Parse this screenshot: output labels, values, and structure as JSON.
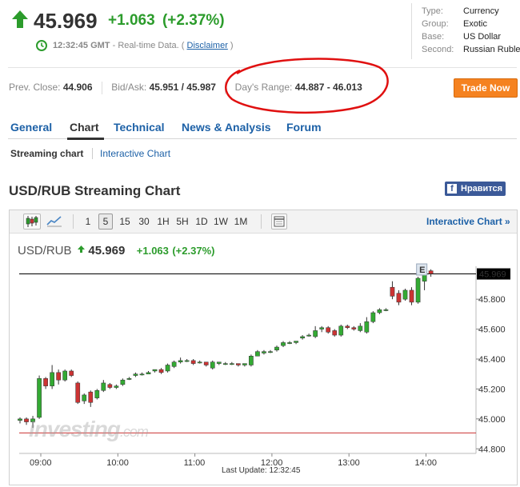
{
  "quote": {
    "last": "45.969",
    "change": "+1.063",
    "change_pct": "(+2.37%)",
    "time": "12:32:45 GMT",
    "realtime_text": "- Real-time Data. (",
    "disclaimer": "Disclaimer",
    "close_paren": ")"
  },
  "info": {
    "type_label": "Type:",
    "type_value": "Currency",
    "group_label": "Group:",
    "group_value": "Exotic",
    "base_label": "Base:",
    "base_value": "US Dollar",
    "second_label": "Second:",
    "second_value": "Russian Ruble"
  },
  "stats": {
    "prev_close_label": "Prev. Close:",
    "prev_close_value": "44.906",
    "bid_ask_label": "Bid/Ask:",
    "bid_ask_value": "45.951 / 45.987",
    "days_range_label": "Day's Range:",
    "days_range_value": "44.887 - 46.013"
  },
  "trade_button": "Trade Now",
  "tabs": [
    "General",
    "Chart",
    "Technical",
    "News & Analysis",
    "Forum"
  ],
  "subtabs": {
    "streaming": "Streaming chart",
    "interactive": "Interactive Chart"
  },
  "page_title": "USD/RUB Streaming Chart",
  "facebook_like": "Нравится",
  "toolbar": {
    "intervals": [
      "1",
      "5",
      "15",
      "30",
      "1H",
      "5H",
      "1D",
      "1W",
      "1M"
    ],
    "selected_interval": "5",
    "interactive_link": "Interactive Chart »"
  },
  "chart_header": {
    "symbol": "USD/RUB",
    "last": "45.969",
    "change": "+1.063",
    "change_pct": "(+2.37%)"
  },
  "watermark": {
    "brand": "investing",
    "suffix": ".com"
  },
  "last_update": "Last Update: 12:32:45",
  "event_marker": "E",
  "colors": {
    "up": "#33aa33",
    "down": "#cc3333",
    "link": "#1d61a7",
    "accent_orange": "#f58220",
    "fb": "#3b5998"
  },
  "icons": [
    "up-arrow-icon",
    "clock-icon",
    "candlestick-icon",
    "line-chart-icon",
    "window-icon",
    "facebook-icon"
  ],
  "chart_data": {
    "type": "candlestick",
    "interval": "5 min",
    "x_ticks": [
      "09:00",
      "10:00",
      "11:00",
      "12:00",
      "13:00",
      "14:00"
    ],
    "y_ticks": [
      "44.800",
      "45.000",
      "45.200",
      "45.400",
      "45.600",
      "45.800"
    ],
    "ylim": [
      44.78,
      46.02
    ],
    "current_price_label": "45.969",
    "current_price": 45.969,
    "prev_close_line": 44.906,
    "start_hour": 8.73,
    "candles": [
      [
        44.99,
        45.0,
        44.97,
        45.01
      ],
      [
        45.0,
        44.98,
        44.96,
        45.01
      ],
      [
        44.98,
        45.0,
        44.94,
        45.02
      ],
      [
        45.01,
        45.27,
        45.0,
        45.29
      ],
      [
        45.27,
        45.22,
        45.2,
        45.28
      ],
      [
        45.22,
        45.31,
        45.2,
        45.36
      ],
      [
        45.31,
        45.26,
        45.23,
        45.33
      ],
      [
        45.26,
        45.32,
        45.25,
        45.33
      ],
      [
        45.32,
        45.29,
        45.28,
        45.33
      ],
      [
        45.24,
        45.11,
        45.1,
        45.25
      ],
      [
        45.12,
        45.16,
        45.1,
        45.17
      ],
      [
        45.18,
        45.11,
        45.08,
        45.19
      ],
      [
        45.14,
        45.19,
        45.13,
        45.2
      ],
      [
        45.19,
        45.24,
        45.18,
        45.26
      ],
      [
        45.23,
        45.21,
        45.2,
        45.24
      ],
      [
        45.21,
        45.22,
        45.2,
        45.23
      ],
      [
        45.23,
        45.26,
        45.22,
        45.27
      ],
      [
        45.27,
        45.27,
        45.26,
        45.28
      ],
      [
        45.29,
        45.3,
        45.28,
        45.31
      ],
      [
        45.3,
        45.3,
        45.29,
        45.31
      ],
      [
        45.3,
        45.31,
        45.3,
        45.32
      ],
      [
        45.32,
        45.33,
        45.31,
        45.33
      ],
      [
        45.33,
        45.31,
        45.3,
        45.34
      ],
      [
        45.32,
        45.36,
        45.31,
        45.37
      ],
      [
        45.35,
        45.38,
        45.34,
        45.39
      ],
      [
        45.38,
        45.39,
        45.37,
        45.41
      ],
      [
        45.39,
        45.39,
        45.38,
        45.4
      ],
      [
        45.39,
        45.37,
        45.36,
        45.4
      ],
      [
        45.38,
        45.38,
        45.37,
        45.39
      ],
      [
        45.38,
        45.36,
        45.35,
        45.38
      ],
      [
        45.34,
        45.38,
        45.33,
        45.39
      ],
      [
        45.37,
        45.38,
        45.36,
        45.38
      ],
      [
        45.37,
        45.37,
        45.36,
        45.38
      ],
      [
        45.37,
        45.37,
        45.36,
        45.38
      ],
      [
        45.37,
        45.36,
        45.35,
        45.37
      ],
      [
        45.36,
        45.37,
        45.35,
        45.37
      ],
      [
        45.36,
        45.42,
        45.35,
        45.43
      ],
      [
        45.42,
        45.45,
        45.42,
        45.46
      ],
      [
        45.44,
        45.45,
        45.43,
        45.46
      ],
      [
        45.45,
        45.45,
        45.44,
        45.46
      ],
      [
        45.46,
        45.48,
        45.45,
        45.49
      ],
      [
        45.49,
        45.51,
        45.48,
        45.52
      ],
      [
        45.51,
        45.51,
        45.5,
        45.52
      ],
      [
        45.51,
        45.52,
        45.5,
        45.52
      ],
      [
        45.54,
        45.55,
        45.53,
        45.56
      ],
      [
        45.56,
        45.56,
        45.55,
        45.57
      ],
      [
        45.55,
        45.59,
        45.54,
        45.62
      ],
      [
        45.6,
        45.61,
        45.58,
        45.62
      ],
      [
        45.61,
        45.58,
        45.57,
        45.62
      ],
      [
        45.59,
        45.56,
        45.55,
        45.6
      ],
      [
        45.56,
        45.62,
        45.55,
        45.63
      ],
      [
        45.62,
        45.61,
        45.6,
        45.63
      ],
      [
        45.61,
        45.6,
        45.59,
        45.62
      ],
      [
        45.59,
        45.62,
        45.58,
        45.64
      ],
      [
        45.58,
        45.65,
        45.57,
        45.68
      ],
      [
        45.65,
        45.71,
        45.64,
        45.72
      ],
      [
        45.71,
        45.73,
        45.7,
        45.74
      ],
      [
        45.73,
        45.73,
        45.72,
        45.74
      ],
      [
        45.88,
        45.82,
        45.8,
        45.92
      ],
      [
        45.84,
        45.78,
        45.76,
        45.86
      ],
      [
        45.8,
        45.86,
        45.79,
        45.87
      ],
      [
        45.86,
        45.78,
        45.76,
        45.88
      ],
      [
        45.78,
        45.94,
        45.77,
        45.95
      ],
      [
        45.92,
        45.97,
        45.86,
        46.01
      ],
      [
        45.99,
        45.97,
        45.95,
        46.0
      ]
    ]
  }
}
